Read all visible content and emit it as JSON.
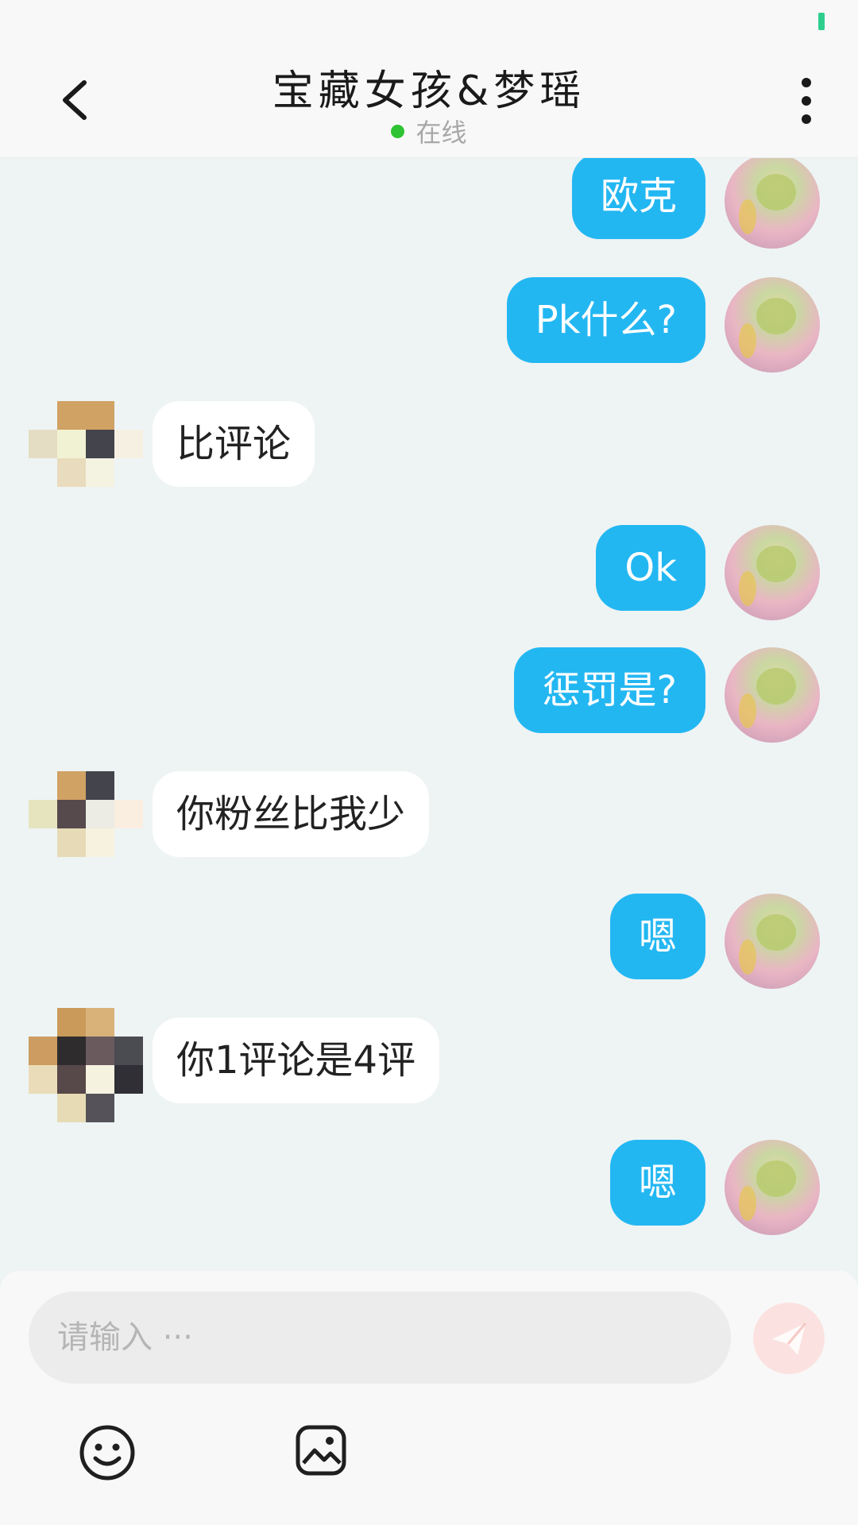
{
  "header": {
    "title": "宝藏女孩&梦瑶",
    "status": "在线"
  },
  "messages": [
    {
      "side": "out",
      "text": "欧克"
    },
    {
      "side": "out",
      "text": "Pk什么?"
    },
    {
      "side": "in",
      "text": "比评论"
    },
    {
      "side": "out",
      "text": "Ok"
    },
    {
      "side": "out",
      "text": "惩罚是?"
    },
    {
      "side": "in",
      "text": "你粉丝比我少"
    },
    {
      "side": "out",
      "text": "嗯"
    },
    {
      "side": "in",
      "text": "你1评论是4评"
    },
    {
      "side": "out",
      "text": "嗯"
    }
  ],
  "composer": {
    "placeholder": "请输入 ···"
  },
  "icons": {
    "back": "chevron-left-icon",
    "more": "more-vertical-icon",
    "send": "paper-plane-icon",
    "emoji": "smiley-icon",
    "image": "image-icon"
  },
  "colors": {
    "outgoing_bubble": "#23b7f2",
    "incoming_bubble": "#ffffff",
    "online": "#2ec332",
    "background": "#eef4f4"
  }
}
